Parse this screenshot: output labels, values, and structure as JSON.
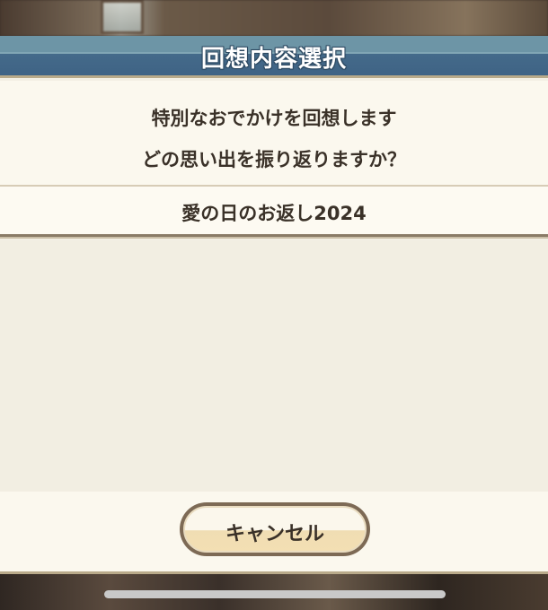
{
  "dialog": {
    "title": "回想内容選択",
    "message_line1": "特別なおでかけを回想します",
    "message_line2": "どの思い出を振り返りますか？",
    "options": [
      {
        "label": "愛の日のお返し2024"
      }
    ],
    "cancel_label": "キャンセル"
  },
  "colors": {
    "title_bar": "#446a8a",
    "panel_bg": "#f3efe4",
    "button_border": "#7d6a55",
    "text": "#3a3128"
  }
}
